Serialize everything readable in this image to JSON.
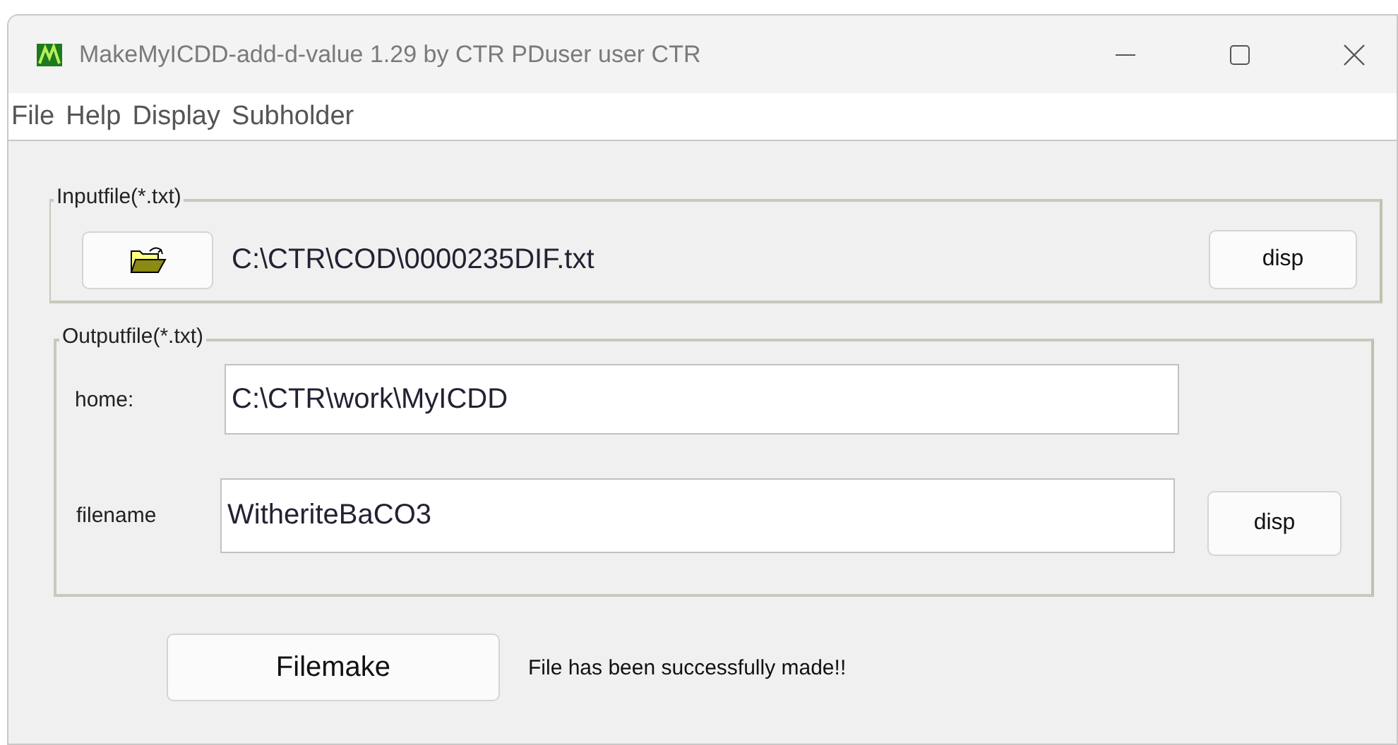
{
  "window": {
    "title": "MakeMyICDD-add-d-value 1.29 by CTR PDuser user CTR"
  },
  "menu": [
    "File",
    "Help",
    "Display",
    "Subholder"
  ],
  "input_group": {
    "legend": "Inputfile(*.txt)",
    "path": "C:\\CTR\\COD\\0000235DIF.txt",
    "button": "disp"
  },
  "output_group": {
    "legend": "Outputfile(*.txt)",
    "home_label": "home:",
    "home_value": "C:\\CTR\\work\\MyICDD",
    "filename_label": "filename",
    "filename_value": "WitheriteBaCO3",
    "button": "disp"
  },
  "make_button": "Filemake",
  "status": "File has been successfully made!!"
}
